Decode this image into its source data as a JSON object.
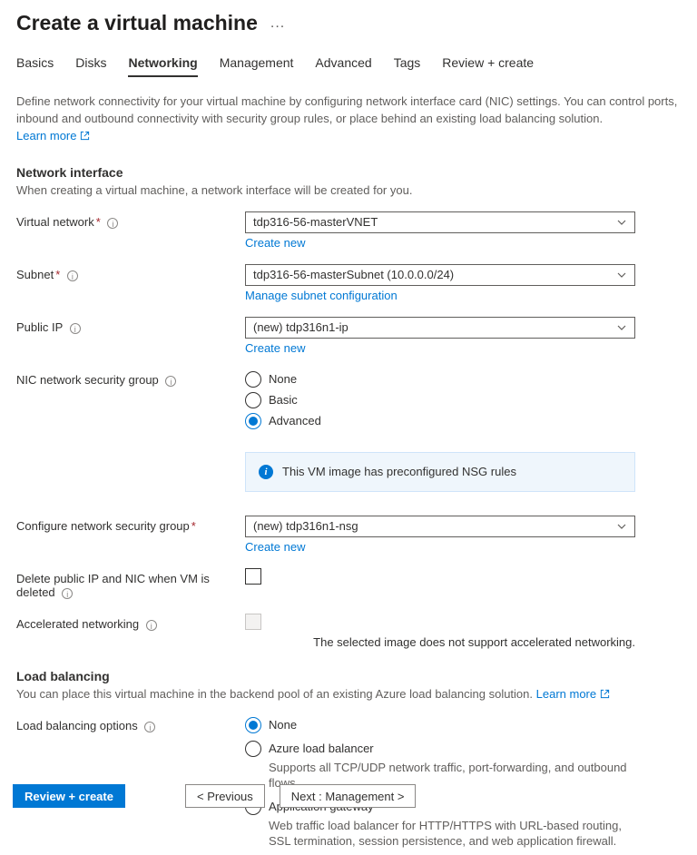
{
  "header": {
    "title": "Create a virtual machine",
    "menu_icon": "..."
  },
  "tabs": {
    "basics": "Basics",
    "disks": "Disks",
    "networking": "Networking",
    "management": "Management",
    "advanced": "Advanced",
    "tags": "Tags",
    "review": "Review + create"
  },
  "intro": {
    "text": "Define network connectivity for your virtual machine by configuring network interface card (NIC) settings. You can control ports, inbound and outbound connectivity with security group rules, or place behind an existing load balancing solution.",
    "learn_more": "Learn more"
  },
  "ni_section": {
    "title": "Network interface",
    "subtitle": "When creating a virtual machine, a network interface will be created for you."
  },
  "vnet": {
    "label": "Virtual network",
    "value": "tdp316-56-masterVNET",
    "create_new": "Create new"
  },
  "subnet": {
    "label": "Subnet",
    "value": "tdp316-56-masterSubnet (10.0.0.0/24)",
    "manage": "Manage subnet configuration"
  },
  "public_ip": {
    "label": "Public IP",
    "value": "(new) tdp316n1-ip",
    "create_new": "Create new"
  },
  "nsg": {
    "label": "NIC network security group",
    "options": {
      "none": "None",
      "basic": "Basic",
      "advanced": "Advanced"
    }
  },
  "nsg_info": {
    "text": "This VM image has preconfigured NSG rules"
  },
  "cfg_nsg": {
    "label": "Configure network security group",
    "value": "(new) tdp316n1-nsg",
    "create_new": "Create new"
  },
  "delete_ip": {
    "label": "Delete public IP and NIC when VM is deleted"
  },
  "accel_net": {
    "label": "Accelerated networking",
    "note": "The selected image does not support accelerated networking."
  },
  "lb_section": {
    "title": "Load balancing",
    "subtitle": "You can place this virtual machine in the backend pool of an existing Azure load balancing solution.",
    "learn_more": "Learn more"
  },
  "lb_options": {
    "label": "Load balancing options",
    "none": "None",
    "alb": "Azure load balancer",
    "alb_sub": "Supports all TCP/UDP network traffic, port-forwarding, and outbound flows.",
    "agw": "Application gateway",
    "agw_sub": "Web traffic load balancer for HTTP/HTTPS with URL-based routing, SSL termination, session persistence, and web application firewall."
  },
  "footer": {
    "review": "Review + create",
    "previous": "< Previous",
    "next": "Next : Management >"
  }
}
